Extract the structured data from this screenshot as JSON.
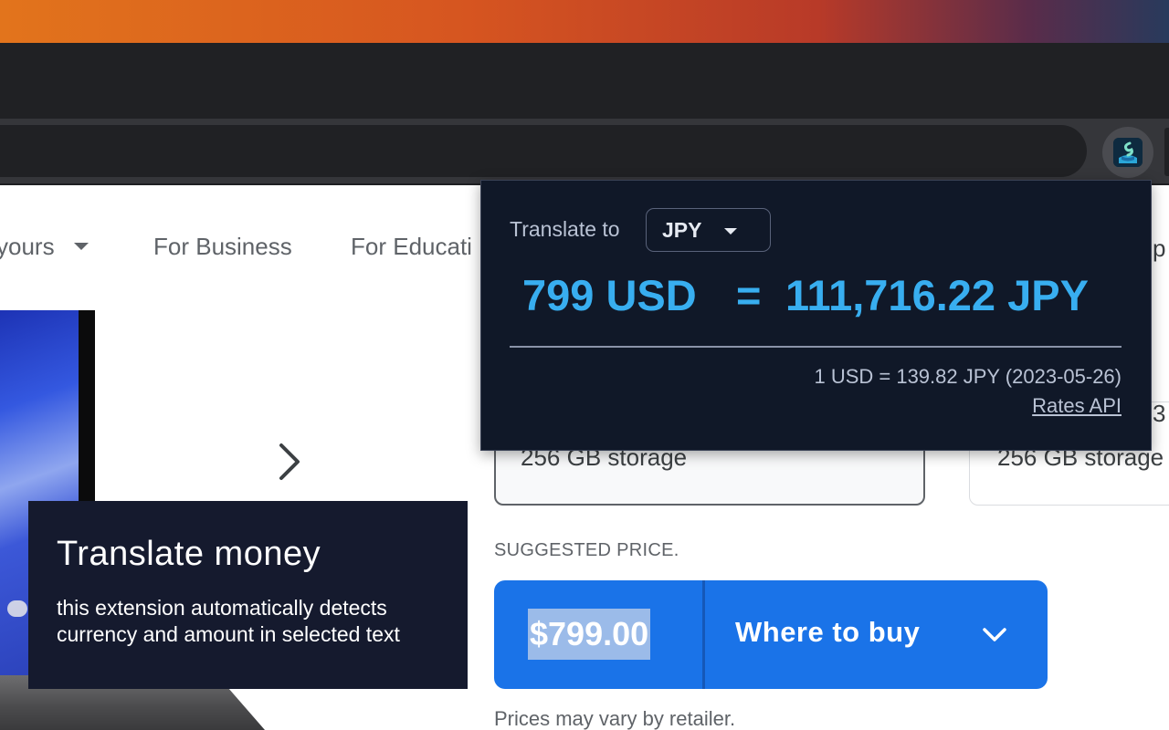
{
  "nav": {
    "item_yours": "yours",
    "item_business": "For Business",
    "item_education": "For Educati"
  },
  "product": {
    "storage_1": "256 GB storage",
    "storage_2": "256 GB storage",
    "peek_right_top": "p",
    "peek_right_card": "3"
  },
  "pricing": {
    "suggested_label": "SUGGESTED PRICE.",
    "price": "$799.00",
    "where_to_buy": "Where to buy",
    "prices_vary": "Prices may vary by retailer."
  },
  "caption": {
    "title": "Translate money",
    "body": "this extension automatically detects currency and amount in selected text"
  },
  "popup": {
    "translate_to_label": "Translate to",
    "selected_currency": "JPY",
    "from_amount": "799 USD",
    "equals": "=",
    "to_amount": "111,716.22 JPY",
    "rate": "1 USD = 139.82 JPY (2023-05-26)",
    "rates_link": "Rates API"
  },
  "colors": {
    "accent_blue": "#38aef0",
    "buy_button": "#1a73e8",
    "popup_bg": "#101828",
    "caption_bg": "#151a2e"
  },
  "icons": {
    "extension": "currency-translator-extension-icon",
    "carousel_next": "chevron-right-icon",
    "dropdown": "chevron-down-icon"
  }
}
